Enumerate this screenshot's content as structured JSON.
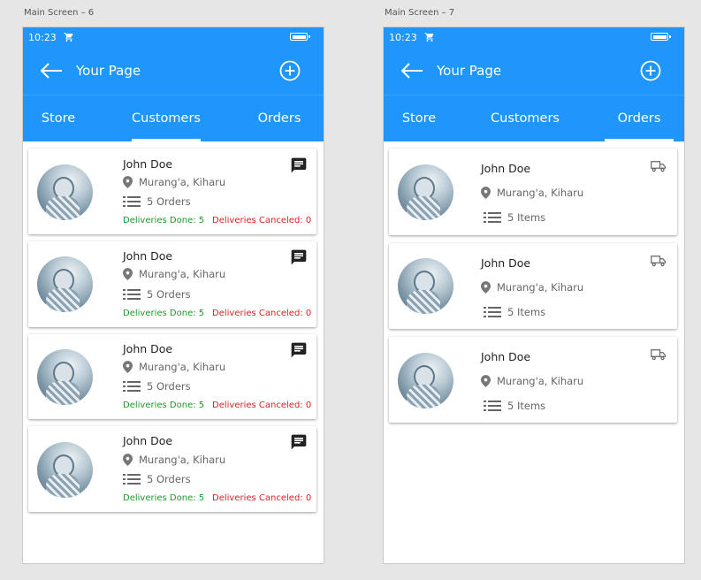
{
  "screens": [
    {
      "label": "Main Screen – 6",
      "status": {
        "time": "10:23"
      },
      "appbar": {
        "title": "Your Page"
      },
      "tabs": [
        "Store",
        "Customers",
        "Orders"
      ],
      "active_tab": 1,
      "cards": [
        {
          "name": "John Doe",
          "location": "Murang'a, Kiharu",
          "count": "5 Orders",
          "done": "Deliveries Done: 5",
          "canceled": "Deliveries Canceled: 0"
        },
        {
          "name": "John Doe",
          "location": "Murang'a, Kiharu",
          "count": "5 Orders",
          "done": "Deliveries Done: 5",
          "canceled": "Deliveries Canceled: 0"
        },
        {
          "name": "John Doe",
          "location": "Murang'a, Kiharu",
          "count": "5 Orders",
          "done": "Deliveries Done: 5",
          "canceled": "Deliveries Canceled: 0"
        },
        {
          "name": "John Doe",
          "location": "Murang'a, Kiharu",
          "count": "5 Orders",
          "done": "Deliveries Done: 5",
          "canceled": "Deliveries Canceled: 0"
        }
      ],
      "card_icon": "chat-icon"
    },
    {
      "label": "Main Screen – 7",
      "status": {
        "time": "10:23"
      },
      "appbar": {
        "title": "Your Page"
      },
      "tabs": [
        "Store",
        "Customers",
        "Orders"
      ],
      "active_tab": 2,
      "cards": [
        {
          "name": "John Doe",
          "location": "Murang'a, Kiharu",
          "count": "5 Items"
        },
        {
          "name": "John Doe",
          "location": "Murang'a, Kiharu",
          "count": "5 Items"
        },
        {
          "name": "John Doe",
          "location": "Murang'a, Kiharu",
          "count": "5 Items"
        }
      ],
      "card_icon": "truck-icon"
    }
  ],
  "colors": {
    "primary": "#1e96fb",
    "done": "#1a9b28",
    "canceled": "#e02020"
  }
}
